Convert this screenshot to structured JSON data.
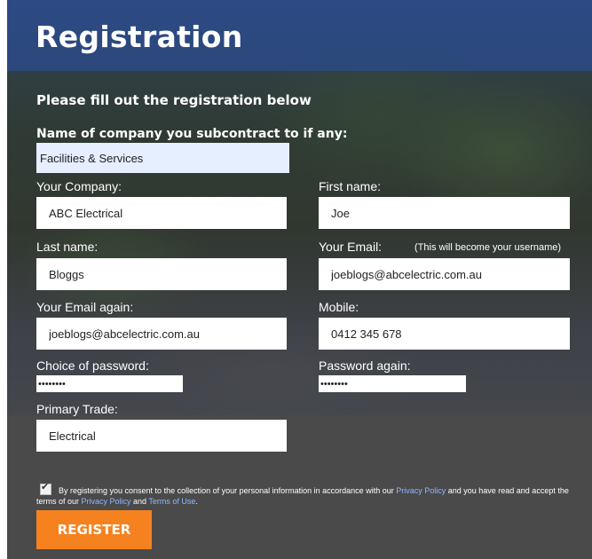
{
  "page": {
    "title": "Registration",
    "subtitle": "Please fill out the registration below"
  },
  "form": {
    "subcontract": {
      "label": "Name of company you subcontract to if any:",
      "value": "Facilities & Services"
    },
    "your_company": {
      "label": "Your Company:",
      "value": "ABC Electrical"
    },
    "first_name": {
      "label": "First name:",
      "value": "Joe"
    },
    "last_name": {
      "label": "Last name:",
      "value": "Bloggs"
    },
    "email": {
      "label": "Your Email:",
      "hint": "(This will become your username)",
      "value": "joeblogs@abcelectric.com.au"
    },
    "email_again": {
      "label": "Your Email again:",
      "value": "joeblogs@abcelectric.com.au"
    },
    "mobile": {
      "label": "Mobile:",
      "value": "0412 345 678"
    },
    "password": {
      "label": "Choice of password:",
      "value": "••••••••"
    },
    "password_again": {
      "label": "Password again:",
      "value": "••••••••"
    },
    "primary_trade": {
      "label": "Primary Trade:",
      "value": "Electrical"
    }
  },
  "consent": {
    "checked": true,
    "text_1": "By registering you consent to the collection of your personal information in accordance with our ",
    "link_privacy_1": "Privacy Policy",
    "text_2": " and you have read and accept the terms of our ",
    "link_privacy_2": "Privacy Policy",
    "text_3": " and ",
    "link_terms": "Terms of Use",
    "text_4": "."
  },
  "actions": {
    "register_label": "REGISTER"
  },
  "colors": {
    "accent_button": "#f5821f",
    "banner": "#2850aa",
    "link": "#8fb8ff",
    "panel_bottom": "#4a4a4a"
  },
  "icons": {
    "checkbox_tick": "check-icon"
  }
}
